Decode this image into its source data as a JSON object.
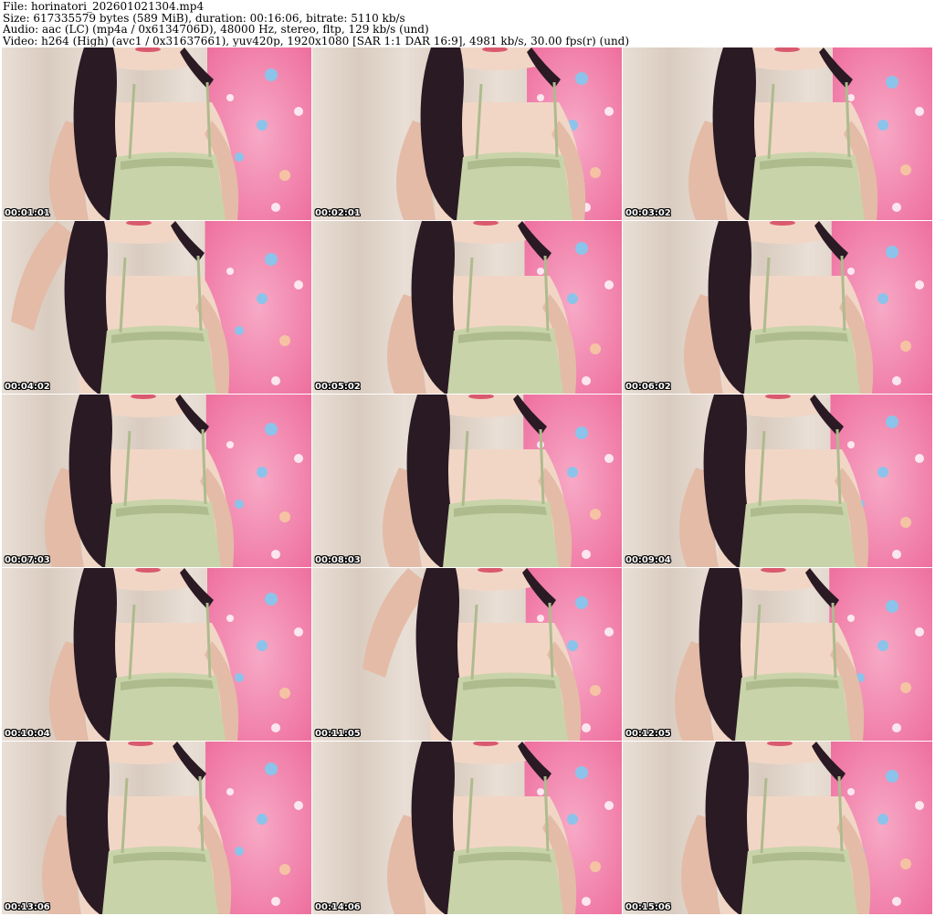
{
  "header": {
    "file": "File: horinatori_202601021304.mp4",
    "size": "Size: 617335579 bytes (589 MiB), duration: 00:16:06, bitrate: 5110 kb/s",
    "audio": "Audio: aac (LC) (mp4a / 0x6134706D), 48000 Hz, stereo, fltp, 129 kb/s (und)",
    "video": "Video: h264 (High) (avc1 / 0x31637661), yuv420p, 1920x1080 [SAR 1:1 DAR 16:9], 4981 kb/s, 30.00 fps(r) (und)"
  },
  "thumbnails": [
    {
      "timestamp": "00:01:01"
    },
    {
      "timestamp": "00:02:01"
    },
    {
      "timestamp": "00:03:02"
    },
    {
      "timestamp": "00:04:02"
    },
    {
      "timestamp": "00:05:02"
    },
    {
      "timestamp": "00:06:02"
    },
    {
      "timestamp": "00:07:03"
    },
    {
      "timestamp": "00:08:03"
    },
    {
      "timestamp": "00:09:04"
    },
    {
      "timestamp": "00:10:04"
    },
    {
      "timestamp": "00:11:05"
    },
    {
      "timestamp": "00:12:05"
    },
    {
      "timestamp": "00:13:06"
    },
    {
      "timestamp": "00:14:06"
    },
    {
      "timestamp": "00:15:06"
    }
  ],
  "colors": {
    "curtain": "#e9dfd6",
    "curtain_fold": "#d9cbbf",
    "pink_backdrop": "#ee6f9e",
    "pink_light": "#f7a9c6",
    "skin": "#f1d6c6",
    "skin_shadow": "#e3bba7",
    "hair": "#2a1a24",
    "dress": "#c9d3a9",
    "dress_shadow": "#aebb8d",
    "heart_blue": "#8cc3ea",
    "heart_peach": "#f5c3a3"
  }
}
